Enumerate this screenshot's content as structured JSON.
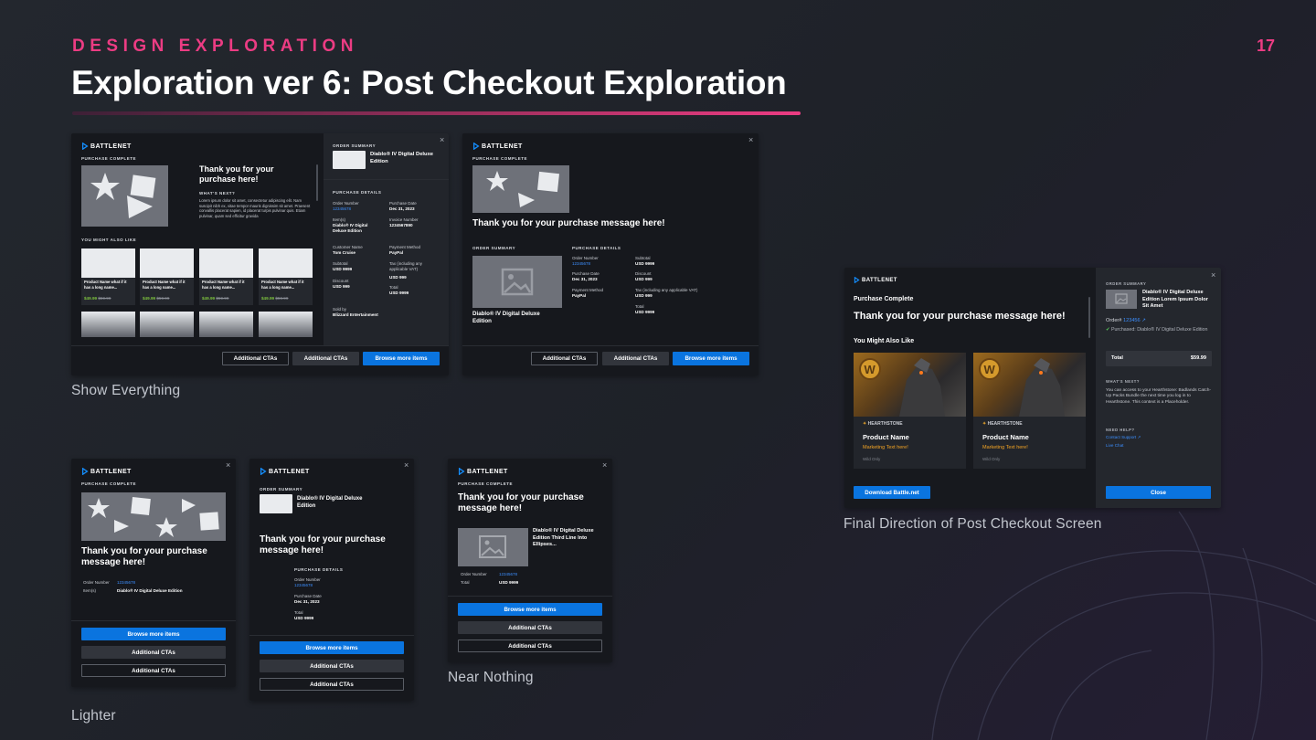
{
  "header": {
    "kicker": "DESIGN EXPLORATION",
    "title": "Exploration ver 6: Post Checkout Exploration",
    "page_number": "17"
  },
  "colors": {
    "accent": "#ec3c83",
    "primary_button": "#0a74df",
    "link": "#3c8fff",
    "price": "#7dc23e",
    "panel": "#16181d"
  },
  "captions": {
    "show_everything": "Show Everything",
    "final_direction": "Final Direction of Post Checkout Screen",
    "lighter": "Lighter",
    "near_nothing": "Near Nothing"
  },
  "common": {
    "brand": "BATTLENET",
    "close_glyph": "×",
    "purchase_complete": "PURCHASE COMPLETE",
    "order_summary": "ORDER SUMMARY",
    "purchase_details": "PURCHASE DETAILS",
    "thank_you": "Thank you for your purchase message here!",
    "browse": "Browse more items",
    "additional_ctas": "Additional CTAs",
    "order_number_label": "Order Number",
    "order_number": "12345678",
    "purchase_date_label": "Purchase Date",
    "purchase_date": "Dec 31, 2023",
    "subtotal_label": "Subtotal",
    "total_label": "Total",
    "usd_9999": "USD 9999",
    "usd_999": "USD 999",
    "discount_label": "Discount",
    "items_label": "Item(s)",
    "product_short": "Diablo® IV Digital Deluxe Edition"
  },
  "show_everything_a": {
    "thank_you": "Thank you for your purchase here!",
    "whats_next": "WHAT'S NEXT?",
    "whats_next_text": "Lorem ipsum dolor sit amet, consectetur adipiscing elit. Nam suscipit nibh ex, vitae tempor mauris dignissim sit amet. Praesent convallis placerat sapien, id placerat turpis pulvinar quis. Etiam pulvinar, quam sed efficitur gravida",
    "you_might_also_like": "YOU MIGHT ALSO LIKE",
    "product_card": {
      "name": "Product Name what if it has a long name...",
      "price": "$49.99",
      "old_price": "$59.99"
    },
    "summary_product": "Diablo® IV Digital Deluxe Edition",
    "invoice_label": "Invoice Number",
    "invoice": "1234567890",
    "items_value": "Diablo® IV Digital Deluxe Edition",
    "customer_label": "Customer Name",
    "customer": "Tom Cruise",
    "payment_label": "Payment Method",
    "payment": "PayPal",
    "tax_label": "Tax (including any applicable VAT)",
    "sold_by_label": "Sold by",
    "sold_by": "Blizzard Entertainment"
  },
  "show_everything_b": {
    "product_name": "Diablo® IV Digital Deluxe Edition",
    "payment_label": "Payment Method",
    "payment": "PayPal",
    "tax_label": "Tax (including any applicable VAT)"
  },
  "final": {
    "purchase_complete": "Purchase Complete",
    "thank_you": "Thank you for your purchase message here!",
    "you_might_also_like": "You Might Also Like",
    "cards": [
      {
        "game": "HEARTHSTONE",
        "name": "Product Name",
        "marketing": "Marketing Text here!",
        "tag": "Wild Only"
      },
      {
        "game": "HEARTHSTONE",
        "name": "Product Name",
        "marketing": "Marketing Text here!",
        "tag": "Wild Only"
      }
    ],
    "download": "Download Battle.net",
    "order_summary": "ORDER SUMMARY",
    "product": "Diablo® IV Digital Deluxe Edition Lorem Ipsum Dolor Sit Amet",
    "order_label": "Order#",
    "order_number": "123456",
    "purchased": "Purchased: Diablo® IV Digital Deluxe Edition",
    "total_label": "Total",
    "total": "$59.99",
    "whats_next": "WHAT'S NEXT?",
    "whats_next_text": "You can access to your Hearthstone: Badlands Catch-Up Packs Bundle the next time you log in to Hearthstone. This context is a Placeholder.",
    "need_help": "NEED HELP?",
    "contact_support": "Contact Support",
    "live_chat": "Live Chat",
    "close": "Close"
  },
  "lighter_a": {
    "thank_you": "Thank you for your purchase message here!"
  },
  "near_nothing": {
    "product": "Diablo® IV Digital Deluxe Edition Third Line Into Ellipses..."
  }
}
